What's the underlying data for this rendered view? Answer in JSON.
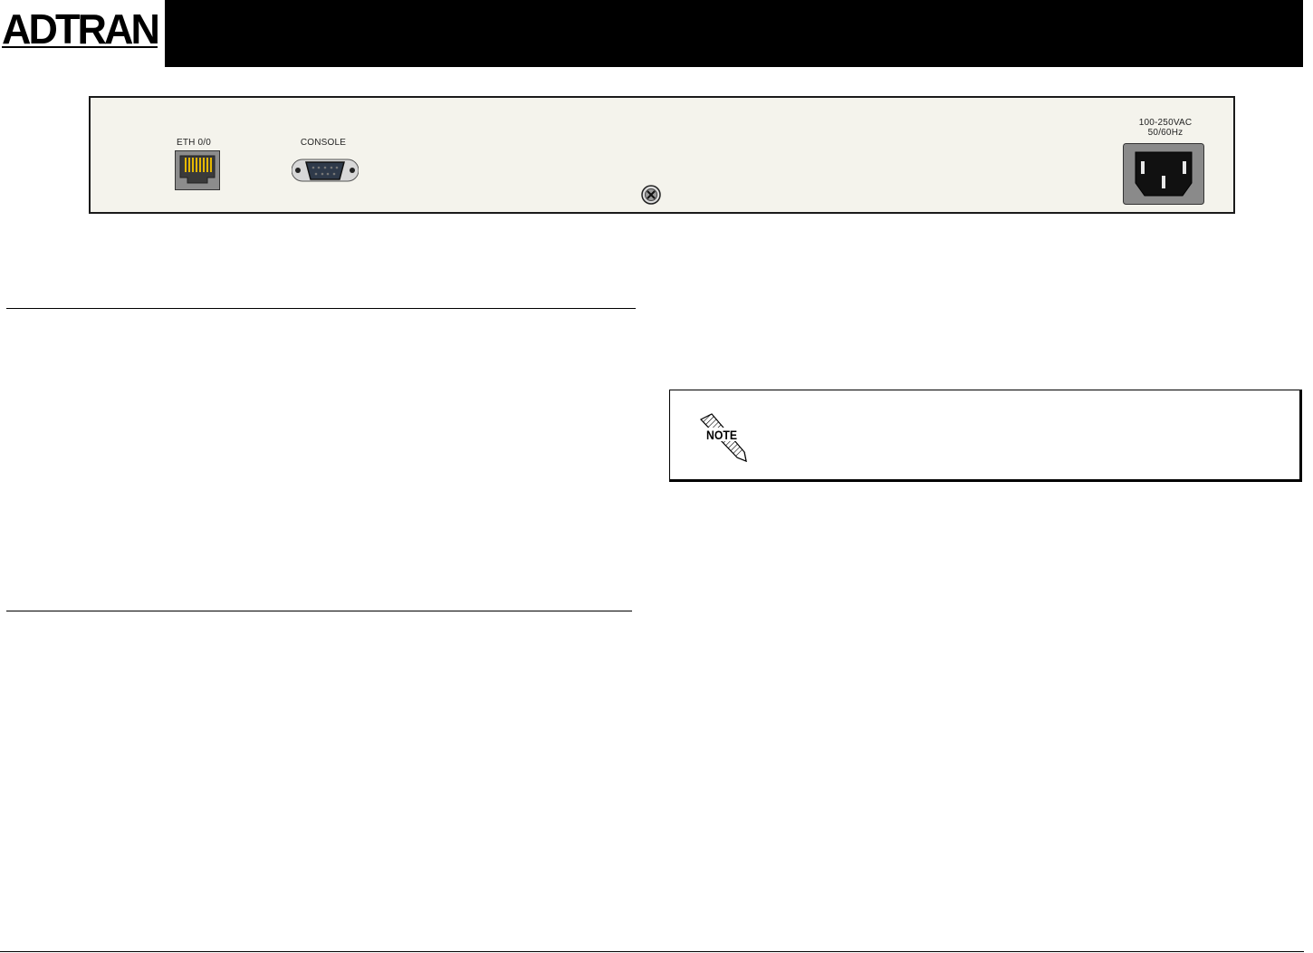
{
  "header": {
    "brand": "ADTRAN",
    "logo_icon": "adtran-logo"
  },
  "rear_panel": {
    "ports": [
      {
        "label": "ETH 0/0",
        "icon": "rj45-ethernet-port-icon"
      },
      {
        "label": "CONSOLE",
        "icon": "db9-serial-port-icon"
      }
    ],
    "power": {
      "voltage": "100-250VAC",
      "frequency": "50/60Hz",
      "icon": "ac-power-inlet-icon"
    },
    "ground_screw_icon": "ground-screw-icon"
  },
  "note": {
    "icon_text": "NOTE",
    "icon": "note-pencil-icon"
  },
  "colors": {
    "header_bar": "#000000",
    "panel_background": "#f4f3ec",
    "eth_contacts": "#e6b800"
  }
}
